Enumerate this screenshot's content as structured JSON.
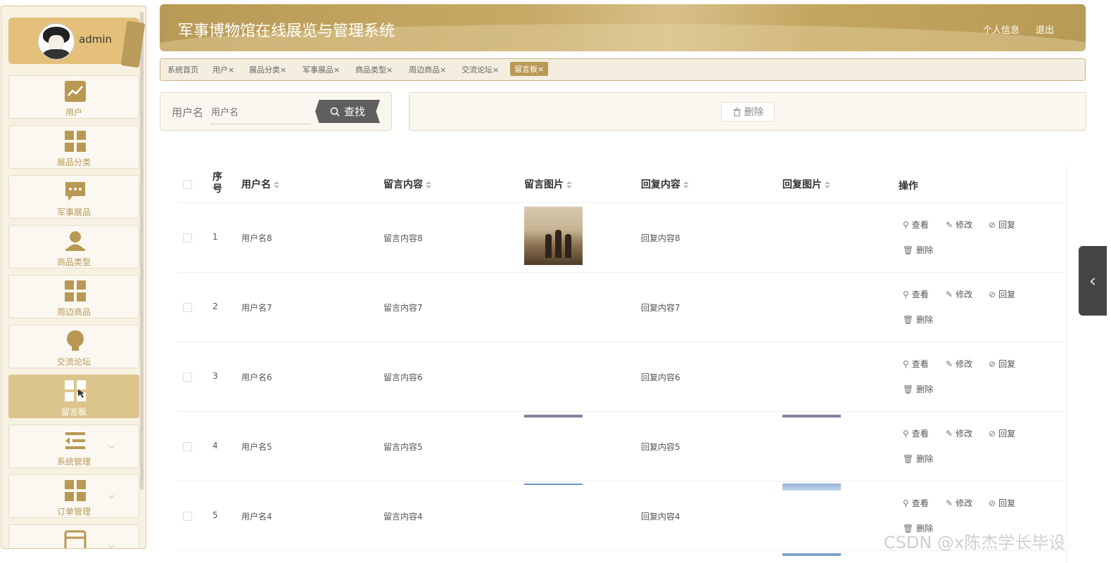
{
  "app": {
    "title": "军事博物馆在线展览与管理系统",
    "profile_link": "个人信息",
    "logout_link": "退出"
  },
  "user": {
    "name": "admin"
  },
  "sidebar": {
    "items": [
      {
        "label": "用户",
        "icon": "chart-line-icon",
        "active": false
      },
      {
        "label": "展品分类",
        "icon": "grid-icon",
        "active": false
      },
      {
        "label": "军事展品",
        "icon": "chat-bubble-icon",
        "active": false
      },
      {
        "label": "商品类型",
        "icon": "user-icon",
        "active": false
      },
      {
        "label": "周边商品",
        "icon": "grid-icon",
        "active": false
      },
      {
        "label": "交流论坛",
        "icon": "lightbulb-icon",
        "active": false
      },
      {
        "label": "留言板",
        "icon": "grid-icon",
        "active": true
      },
      {
        "label": "系统管理",
        "icon": "menu-list-icon",
        "active": false,
        "expandable": true
      },
      {
        "label": "订单管理",
        "icon": "grid-icon",
        "active": false,
        "expandable": true
      },
      {
        "label": "",
        "icon": "card-icon",
        "active": false,
        "expandable": true
      }
    ]
  },
  "tabs": [
    {
      "label": "系统首页",
      "closable": false
    },
    {
      "label": "用户",
      "closable": true
    },
    {
      "label": "展品分类",
      "closable": true
    },
    {
      "label": "军事展品",
      "closable": true
    },
    {
      "label": "商品类型",
      "closable": true
    },
    {
      "label": "周边商品",
      "closable": true
    },
    {
      "label": "交流论坛",
      "closable": true
    },
    {
      "label": "留言板",
      "closable": true,
      "active": true
    }
  ],
  "tab_close_glyph": "×",
  "search": {
    "label": "用户名",
    "placeholder": "用户名",
    "button": "查找"
  },
  "actions": {
    "delete": "删除"
  },
  "table": {
    "headers": {
      "index": "序号",
      "username": "用户名",
      "content": "留言内容",
      "image": "留言图片",
      "reply": "回复内容",
      "reply_image": "回复图片",
      "ops": "操作"
    },
    "op_labels": {
      "view": "查看",
      "edit": "修改",
      "reply": "回复",
      "delete": "删除"
    },
    "rows": [
      {
        "index": "1",
        "username": "用户名8",
        "content": "留言内容8",
        "reply": "回复内容8"
      },
      {
        "index": "2",
        "username": "用户名7",
        "content": "留言内容7",
        "reply": "回复内容7"
      },
      {
        "index": "3",
        "username": "用户名6",
        "content": "留言内容6",
        "reply": "回复内容6"
      },
      {
        "index": "4",
        "username": "用户名5",
        "content": "留言内容5",
        "reply": "回复内容5"
      },
      {
        "index": "5",
        "username": "用户名4",
        "content": "留言内容4",
        "reply": "回复内容4"
      }
    ]
  },
  "watermark": "CSDN @x陈杰学长毕设",
  "colors": {
    "accent": "#b89a55",
    "header": "#c3a660",
    "active_menu": "#dcc58d"
  }
}
